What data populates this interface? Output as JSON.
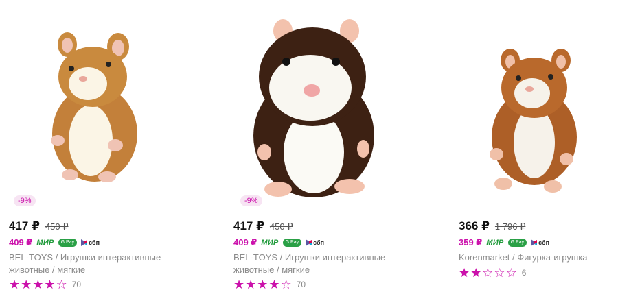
{
  "accent_color": "#cb11ab",
  "products": [
    {
      "image": "hamster-plush-ginger",
      "discount": "-9%",
      "price": "417 ₽",
      "old_price": "450 ₽",
      "wallet_price": "409 ₽",
      "payment_badges": {
        "mir": "МИР",
        "gpay": "G Pay",
        "sbp": "сбп"
      },
      "brand": "BEL-TOYS",
      "separator": " / ",
      "name": "Игрушки интерактивные животные / мягкие",
      "rating": 4,
      "stars": [
        "★",
        "★",
        "★",
        "★",
        "☆"
      ],
      "reviews": "70"
    },
    {
      "image": "hamster-plush-brown",
      "discount": "-9%",
      "price": "417 ₽",
      "old_price": "450 ₽",
      "wallet_price": "409 ₽",
      "payment_badges": {
        "mir": "МИР",
        "gpay": "G Pay",
        "sbp": "сбп"
      },
      "brand": "BEL-TOYS",
      "separator": " / ",
      "name": "Игрушки интерактивные животные / мягкие",
      "rating": 4,
      "stars": [
        "★",
        "★",
        "★",
        "★",
        "☆"
      ],
      "reviews": "70"
    },
    {
      "image": "hamster-plush-orange",
      "price": "366 ₽",
      "old_price": "1 796 ₽",
      "wallet_price": "359 ₽",
      "payment_badges": {
        "mir": "МИР",
        "gpay": "G Pay",
        "sbp": "сбп"
      },
      "brand": "Korenmarket",
      "separator": " / ",
      "name": "Фигурка-игрушка",
      "rating": 2,
      "stars": [
        "★",
        "★",
        "☆",
        "☆",
        "☆"
      ],
      "reviews": "6"
    }
  ]
}
